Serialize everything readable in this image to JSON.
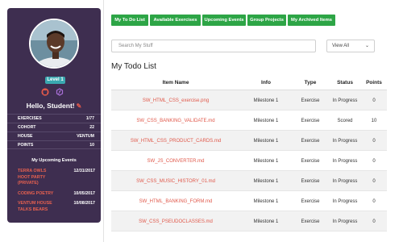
{
  "sidebar": {
    "level": "Level 1",
    "greeting": "Hello, Student!",
    "stats": [
      {
        "label": "EXERCISES",
        "value": "1/77"
      },
      {
        "label": "COHORT",
        "value": "22"
      },
      {
        "label": "HOUSE",
        "value": "VENTUM"
      },
      {
        "label": "POINTS",
        "value": "10"
      }
    ],
    "events_title": "My Upcoming Events",
    "events": [
      {
        "name": "TERRA OWLS HOOT PARTY (PRIVATE)",
        "date": "12/31/2017"
      },
      {
        "name": "CODING POETRY",
        "date": "10/05/2017"
      },
      {
        "name": "VENTUM HOUSE TALKS BEARS",
        "date": "10/08/2017"
      }
    ]
  },
  "tabs": [
    "My To Do List",
    "Available Exercises",
    "Upcoming Events",
    "Group Projects",
    "My Archived Items"
  ],
  "search": {
    "placeholder": "Search My Stuff"
  },
  "view": {
    "selected": "View All"
  },
  "main": {
    "title": "My Todo List"
  },
  "table": {
    "headers": {
      "name": "Item Name",
      "info": "Info",
      "type": "Type",
      "status": "Status",
      "points": "Points"
    },
    "rows": [
      {
        "name": "SW_HTML_CSS_exercise.png",
        "info": "Milestone 1",
        "type": "Exercise",
        "status": "In Progress",
        "points": "0"
      },
      {
        "name": "SW_CSS_BANKING_VALIDATE.md",
        "info": "Milestone 1",
        "type": "Exercise",
        "status": "Scored",
        "points": "10"
      },
      {
        "name": "SW_HTML_CSS_PRODUCT_CARDS.md",
        "info": "Milestone 1",
        "type": "Exercise",
        "status": "In Progress",
        "points": "0"
      },
      {
        "name": "SW_JS_CONVERTER.md",
        "info": "Milestone 1",
        "type": "Exercise",
        "status": "In Progress",
        "points": "0"
      },
      {
        "name": "SW_CSS_MUSIC_HISTORY_01.md",
        "info": "Milestone 1",
        "type": "Exercise",
        "status": "In Progress",
        "points": "0"
      },
      {
        "name": "SW_HTML_BANKING_FORM.md",
        "info": "Milestone 1",
        "type": "Exercise",
        "status": "In Progress",
        "points": "0"
      },
      {
        "name": "SW_CSS_PSEUDOCLASSES.md",
        "info": "Milestone 1",
        "type": "Exercise",
        "status": "In Progress",
        "points": "0"
      }
    ]
  }
}
